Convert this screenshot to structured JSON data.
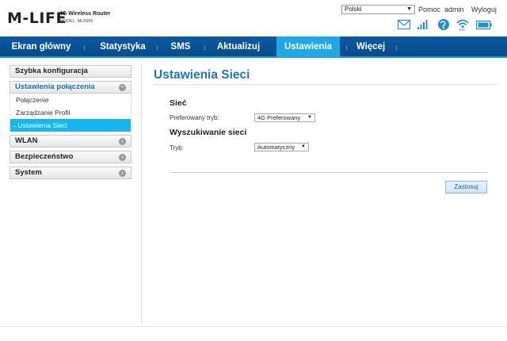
{
  "header": {
    "logo": "M-LIFE",
    "product": "4G Wireless Router",
    "model": "MODEL: ML0655",
    "language": "Polski",
    "help": "Pomoc",
    "user": "admin",
    "logout": "Wyloguj",
    "status_icons": [
      "mail-icon",
      "signal-icon",
      "internet-globe-icon",
      "wifi-icon",
      "battery-icon"
    ]
  },
  "nav": {
    "items": [
      "Ekran główny",
      "Statystyka",
      "SMS",
      "Aktualizuj",
      "Ustawienia",
      "Więcej"
    ],
    "active": "Ustawienia"
  },
  "sidebar": {
    "quick": "Szybka konfiguracja",
    "connection": "Ustawienia połączenia",
    "sub": [
      "Połączenie",
      "Zarządzanie Profil",
      "Ustawienia Sieci"
    ],
    "active_sub_prefix": "→",
    "wlan": "WLAN",
    "security": "Bezpieczeństwo",
    "system": "System"
  },
  "main": {
    "title": "Ustawienia Sieci",
    "network_section": "Sieć",
    "preferred_mode_label": "Preferowany tryb:",
    "preferred_mode_value": "4G Preferowany",
    "search_section": "Wyszukiwanie sieci",
    "mode_label": "Tryb:",
    "mode_value": "Automatyczny",
    "apply": "Zastosuj"
  },
  "colors": {
    "nav_bg": "#0d5aa3",
    "nav_active": "#1fa7e6",
    "accent": "#1e73be",
    "sidebar_active": "#16b6f0"
  }
}
